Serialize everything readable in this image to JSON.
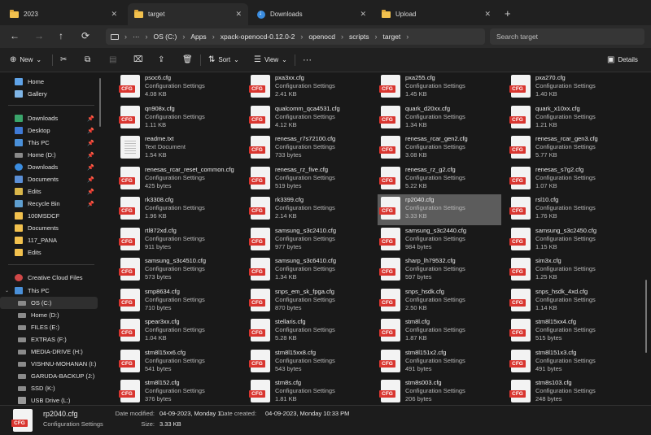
{
  "tabs": [
    {
      "label": "2023",
      "icon": "folder-icon"
    },
    {
      "label": "target",
      "icon": "folder-icon"
    },
    {
      "label": "Downloads",
      "icon": "download-icon"
    },
    {
      "label": "Upload",
      "icon": "folder-icon"
    }
  ],
  "address": {
    "more": "···",
    "crumbs": [
      "OS (C:)",
      "Apps",
      "xpack-openocd-0.12.0-2",
      "openocd",
      "scripts",
      "target"
    ],
    "search_placeholder": "Search target"
  },
  "toolbar": {
    "new_label": "New",
    "sort_label": "Sort",
    "view_label": "View",
    "more_label": "···",
    "details_label": "Details"
  },
  "sidebar": {
    "items": [
      {
        "label": "Home",
        "icon": "home-icon"
      },
      {
        "label": "Gallery",
        "icon": "gallery-icon"
      },
      {
        "label": "Downloads",
        "icon": "downloads-icon",
        "pinned": true
      },
      {
        "label": "Desktop",
        "icon": "desktop-icon",
        "pinned": true
      },
      {
        "label": "This PC",
        "icon": "pc-icon",
        "pinned": true
      },
      {
        "label": "Home (D:)",
        "icon": "drive-icon",
        "pinned": true
      },
      {
        "label": "Downloads",
        "icon": "downloads-icon",
        "pinned": true
      },
      {
        "label": "Documents",
        "icon": "documents-icon",
        "pinned": true
      },
      {
        "label": "Edits",
        "icon": "edits-icon",
        "pinned": true
      },
      {
        "label": "Recycle Bin",
        "icon": "recycle-bin-icon",
        "pinned": true
      },
      {
        "label": "100MSDCF",
        "icon": "folder-icon"
      },
      {
        "label": "Documents",
        "icon": "folder-icon"
      },
      {
        "label": "117_PANA",
        "icon": "folder-icon"
      },
      {
        "label": "Edits",
        "icon": "folder-icon"
      },
      {
        "label": "Creative Cloud Files",
        "icon": "creative-cloud-icon"
      },
      {
        "label": "This PC",
        "icon": "pc-icon"
      },
      {
        "label": "OS (C:)",
        "icon": "drive-icon"
      },
      {
        "label": "Home (D:)",
        "icon": "drive-icon"
      },
      {
        "label": "FILES (E:)",
        "icon": "drive-icon"
      },
      {
        "label": "EXTRAS (F:)",
        "icon": "drive-icon"
      },
      {
        "label": "MEDIA-DRIVE (H:)",
        "icon": "drive-icon"
      },
      {
        "label": "VISHNU-MOHANAN (I:)",
        "icon": "drive-icon"
      },
      {
        "label": "GARUDA-BACKUP (J:)",
        "icon": "drive-icon"
      },
      {
        "label": "SSD (K:)",
        "icon": "drive-icon"
      },
      {
        "label": "USB Drive (L:)",
        "icon": "usb-drive-icon"
      }
    ]
  },
  "files": [
    {
      "name": "psoc6.cfg",
      "type": "Configuration Settings",
      "size": "4.08 KB"
    },
    {
      "name": "pxa3xx.cfg",
      "type": "Configuration Settings",
      "size": "2.41 KB"
    },
    {
      "name": "pxa255.cfg",
      "type": "Configuration Settings",
      "size": "1.45 KB"
    },
    {
      "name": "pxa270.cfg",
      "type": "Configuration Settings",
      "size": "1.40 KB"
    },
    {
      "name": "qn908x.cfg",
      "type": "Configuration Settings",
      "size": "1.11 KB"
    },
    {
      "name": "qualcomm_qca4531.cfg",
      "type": "Configuration Settings",
      "size": "4.12 KB"
    },
    {
      "name": "quark_d20xx.cfg",
      "type": "Configuration Settings",
      "size": "1.34 KB"
    },
    {
      "name": "quark_x10xx.cfg",
      "type": "Configuration Settings",
      "size": "1.21 KB"
    },
    {
      "name": "readme.txt",
      "type": "Text Document",
      "size": "1.54 KB",
      "kind": "txt"
    },
    {
      "name": "renesas_r7s72100.cfg",
      "type": "Configuration Settings",
      "size": "733 bytes"
    },
    {
      "name": "renesas_rcar_gen2.cfg",
      "type": "Configuration Settings",
      "size": "3.08 KB"
    },
    {
      "name": "renesas_rcar_gen3.cfg",
      "type": "Configuration Settings",
      "size": "5.77 KB"
    },
    {
      "name": "renesas_rcar_reset_common.cfg",
      "type": "Configuration Settings",
      "size": "425 bytes"
    },
    {
      "name": "renesas_rz_five.cfg",
      "type": "Configuration Settings",
      "size": "519 bytes"
    },
    {
      "name": "renesas_rz_g2.cfg",
      "type": "Configuration Settings",
      "size": "5.22 KB"
    },
    {
      "name": "renesas_s7g2.cfg",
      "type": "Configuration Settings",
      "size": "1.07 KB"
    },
    {
      "name": "rk3308.cfg",
      "type": "Configuration Settings",
      "size": "1.96 KB"
    },
    {
      "name": "rk3399.cfg",
      "type": "Configuration Settings",
      "size": "2.14 KB"
    },
    {
      "name": "rp2040.cfg",
      "type": "Configuration Settings",
      "size": "3.33 KB",
      "selected": true
    },
    {
      "name": "rsl10.cfg",
      "type": "Configuration Settings",
      "size": "1.76 KB"
    },
    {
      "name": "rtl872xd.cfg",
      "type": "Configuration Settings",
      "size": "911 bytes"
    },
    {
      "name": "samsung_s3c2410.cfg",
      "type": "Configuration Settings",
      "size": "977 bytes"
    },
    {
      "name": "samsung_s3c2440.cfg",
      "type": "Configuration Settings",
      "size": "984 bytes"
    },
    {
      "name": "samsung_s3c2450.cfg",
      "type": "Configuration Settings",
      "size": "1.15 KB"
    },
    {
      "name": "samsung_s3c4510.cfg",
      "type": "Configuration Settings",
      "size": "573 bytes"
    },
    {
      "name": "samsung_s3c6410.cfg",
      "type": "Configuration Settings",
      "size": "1.34 KB"
    },
    {
      "name": "sharp_lh79532.cfg",
      "type": "Configuration Settings",
      "size": "597 bytes"
    },
    {
      "name": "sim3x.cfg",
      "type": "Configuration Settings",
      "size": "1.25 KB"
    },
    {
      "name": "smp8634.cfg",
      "type": "Configuration Settings",
      "size": "710 bytes"
    },
    {
      "name": "snps_em_sk_fpga.cfg",
      "type": "Configuration Settings",
      "size": "870 bytes"
    },
    {
      "name": "snps_hsdk.cfg",
      "type": "Configuration Settings",
      "size": "2.50 KB"
    },
    {
      "name": "snps_hsdk_4xd.cfg",
      "type": "Configuration Settings",
      "size": "1.14 KB"
    },
    {
      "name": "spear3xx.cfg",
      "type": "Configuration Settings",
      "size": "1.04 KB"
    },
    {
      "name": "stellaris.cfg",
      "type": "Configuration Settings",
      "size": "5.28 KB"
    },
    {
      "name": "stm8l.cfg",
      "type": "Configuration Settings",
      "size": "1.87 KB"
    },
    {
      "name": "stm8l15xx4.cfg",
      "type": "Configuration Settings",
      "size": "515 bytes"
    },
    {
      "name": "stm8l15xx6.cfg",
      "type": "Configuration Settings",
      "size": "541 bytes"
    },
    {
      "name": "stm8l15xx8.cfg",
      "type": "Configuration Settings",
      "size": "543 bytes"
    },
    {
      "name": "stm8l151x2.cfg",
      "type": "Configuration Settings",
      "size": "491 bytes"
    },
    {
      "name": "stm8l151x3.cfg",
      "type": "Configuration Settings",
      "size": "491 bytes"
    },
    {
      "name": "stm8l152.cfg",
      "type": "Configuration Settings",
      "size": "376 bytes"
    },
    {
      "name": "stm8s.cfg",
      "type": "Configuration Settings",
      "size": "1.81 KB"
    },
    {
      "name": "stm8s003.cfg",
      "type": "Configuration Settings",
      "size": "206 bytes"
    },
    {
      "name": "stm8s103.cfg",
      "type": "Configuration Settings",
      "size": "248 bytes"
    }
  ],
  "file_badge": "CFG",
  "details": {
    "name": "rp2040.cfg",
    "type": "Configuration Settings",
    "modified_label": "Date modified:",
    "modified_value": "04-09-2023, Monday 1...",
    "created_label": "Date created:",
    "created_value": "04-09-2023, Monday 10:33 PM",
    "size_label": "Size:",
    "size_value": "3.33 KB"
  },
  "colors": {
    "background": "#191919",
    "selection": "#5c5c5c",
    "cfg_badge": "#d9352f",
    "folder": "#f2c14e"
  }
}
